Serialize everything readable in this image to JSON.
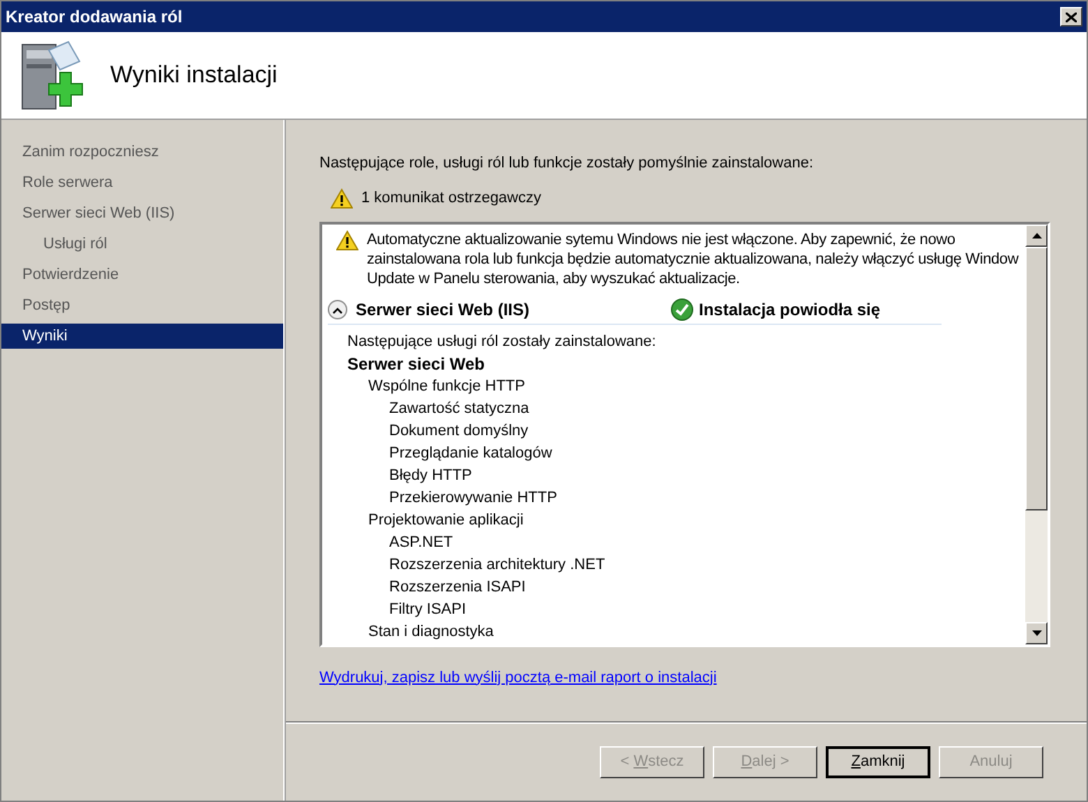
{
  "window": {
    "title": "Kreator dodawania ról"
  },
  "header": {
    "title": "Wyniki instalacji"
  },
  "sidebar": {
    "items": [
      {
        "label": "Zanim rozpoczniesz",
        "selected": false
      },
      {
        "label": "Role serwera",
        "selected": false
      },
      {
        "label": "Serwer sieci Web (IIS)",
        "selected": false,
        "children": [
          {
            "label": "Usługi ról",
            "selected": false
          }
        ]
      },
      {
        "label": "Potwierdzenie",
        "selected": false
      },
      {
        "label": "Postęp",
        "selected": false
      },
      {
        "label": "Wyniki",
        "selected": true
      }
    ]
  },
  "intro": "Następujące role, usługi ról lub funkcje zostały pomyślnie zainstalowane:",
  "warning_count": "1 komunikat ostrzegawczy",
  "results": {
    "warning": "Automatyczne aktualizowanie sytemu Windows nie jest włączone. Aby zapewnić, że nowo zainstalowana rola lub funkcja będzie automatycznie aktualizowana, należy włączyć usługę Window",
    "warning_tail": "Update w Panelu sterowania, aby wyszukać aktualizacje.",
    "section": {
      "title": "Serwer sieci Web (IIS)",
      "expanded": true,
      "status": "Instalacja powiodła się"
    },
    "list_heading": "Następujące usługi ról zostały zainstalowane:",
    "tree": [
      {
        "label": "Serwer sieci Web",
        "children": [
          {
            "label": "Wspólne funkcje HTTP",
            "children": [
              {
                "label": "Zawartość statyczna"
              },
              {
                "label": "Dokument domyślny"
              },
              {
                "label": "Przeglądanie katalogów"
              },
              {
                "label": "Błędy HTTP"
              },
              {
                "label": "Przekierowywanie HTTP"
              }
            ]
          },
          {
            "label": "Projektowanie aplikacji",
            "children": [
              {
                "label": "ASP.NET"
              },
              {
                "label": "Rozszerzenia architektury .NET"
              },
              {
                "label": "Rozszerzenia ISAPI"
              },
              {
                "label": "Filtry ISAPI"
              }
            ]
          },
          {
            "label": "Stan i diagnostyka"
          }
        ]
      }
    ]
  },
  "report_link": "Wydrukuj, zapisz lub wyślij pocztą e-mail raport o instalacji",
  "buttons": [
    {
      "before": "< ",
      "key": "W",
      "after": "stecz",
      "disabled": true,
      "default": false
    },
    {
      "key": "D",
      "after": "alej >",
      "disabled": true,
      "default": false
    },
    {
      "key": "Z",
      "after": "amknij",
      "disabled": false,
      "default": true
    },
    {
      "before": "Anuluj",
      "disabled": true,
      "default": false
    }
  ]
}
